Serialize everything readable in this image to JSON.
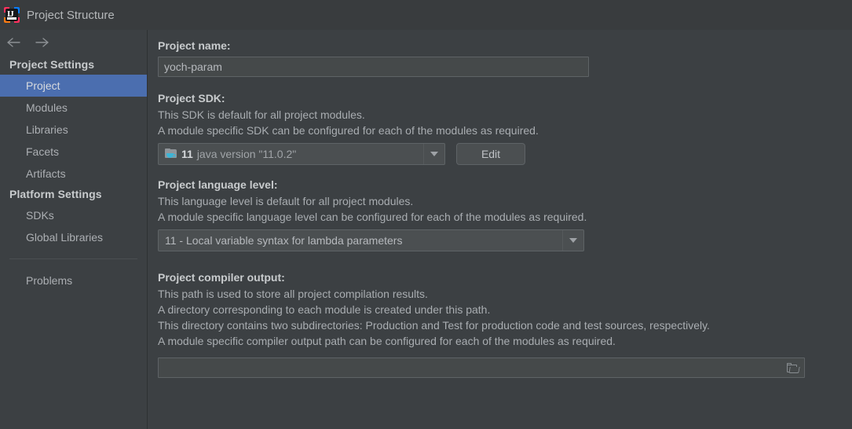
{
  "window": {
    "title": "Project Structure",
    "app_icon": "intellij-idea-icon",
    "icon_glyph": "IJ"
  },
  "sidebar": {
    "nav": {
      "back_icon": "arrow-left-icon",
      "forward_icon": "arrow-right-icon"
    },
    "groups": [
      {
        "title": "Project Settings",
        "items": [
          {
            "label": "Project",
            "selected": true
          },
          {
            "label": "Modules",
            "selected": false
          },
          {
            "label": "Libraries",
            "selected": false
          },
          {
            "label": "Facets",
            "selected": false
          },
          {
            "label": "Artifacts",
            "selected": false
          }
        ]
      },
      {
        "title": "Platform Settings",
        "items": [
          {
            "label": "SDKs",
            "selected": false
          },
          {
            "label": "Global Libraries",
            "selected": false
          }
        ]
      }
    ],
    "extra_items": [
      {
        "label": "Problems",
        "selected": false
      }
    ]
  },
  "main": {
    "project_name": {
      "label": "Project name:",
      "value": "yoch-param"
    },
    "project_sdk": {
      "label": "Project SDK:",
      "desc_line_1": "This SDK is default for all project modules.",
      "desc_line_2": "A module specific SDK can be configured for each of the modules as required.",
      "selected_version": "11",
      "selected_description": "java version \"11.0.2\"",
      "icon": "java-sdk-folder-icon",
      "dropdown_icon": "chevron-down-icon",
      "edit_button": "Edit"
    },
    "language_level": {
      "label": "Project language level:",
      "desc_line_1": "This language level is default for all project modules.",
      "desc_line_2": "A module specific language level can be configured for each of the modules as required.",
      "selected": "11 - Local variable syntax for lambda parameters",
      "dropdown_icon": "chevron-down-icon"
    },
    "compiler_output": {
      "label": "Project compiler output:",
      "desc_line_1": "This path is used to store all project compilation results.",
      "desc_line_2": "A directory corresponding to each module is created under this path.",
      "desc_line_3": "This directory contains two subdirectories: Production and Test for production code and test sources, respectively.",
      "desc_line_4": "A module specific compiler output path can be configured for each of the modules as required.",
      "value": "",
      "browse_icon": "folder-open-icon"
    }
  },
  "colors": {
    "background": "#3c4043",
    "titlebar": "#393c3e",
    "selection": "#4b6eaf",
    "field": "#45494a",
    "border": "#5e6366",
    "text": "#a9adb1",
    "text_bold": "#c8cbcd",
    "accent_cyan": "#3cb4d6"
  }
}
